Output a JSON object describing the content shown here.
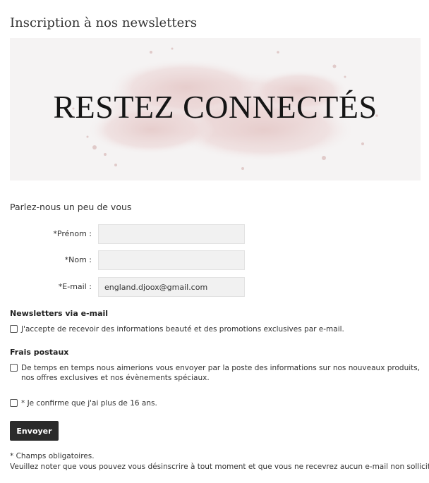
{
  "page": {
    "title": "Inscription à nos newsletters"
  },
  "banner": {
    "text": "RESTEZ CONNECTÉS",
    "background_color": "#f5f3f3",
    "powder_color": "#e8cfcf"
  },
  "form": {
    "intro": "Parlez-nous un peu de vous",
    "fields": {
      "first_name": {
        "label": "*Prénom :",
        "value": ""
      },
      "last_name": {
        "label": "*Nom :",
        "value": ""
      },
      "email": {
        "label": "*E-mail :",
        "value": "england.djoox@gmail.com"
      }
    },
    "newsletter_group": {
      "title": "Newsletters via e-mail",
      "consent_label": "J'accepte de recevoir des informations beauté et des promotions exclusives par e-mail."
    },
    "postal_group": {
      "title": "Frais postaux",
      "consent_label": "De temps en temps nous aimerions vous envoyer par la poste des informations sur nos nouveaux produits, nos offres exclusives et nos évènements spéciaux."
    },
    "age_confirm_label": "* Je confirme que j'ai plus de 16 ans.",
    "submit_label": "Envoyer",
    "submit_color": "#2b2b2b"
  },
  "footer": {
    "required_note": "* Champs obligatoires.",
    "unsubscribe_note": "Veuillez noter que vous pouvez vous désinscrire à tout moment et que vous ne recevrez aucun e-mail non sollicité."
  }
}
